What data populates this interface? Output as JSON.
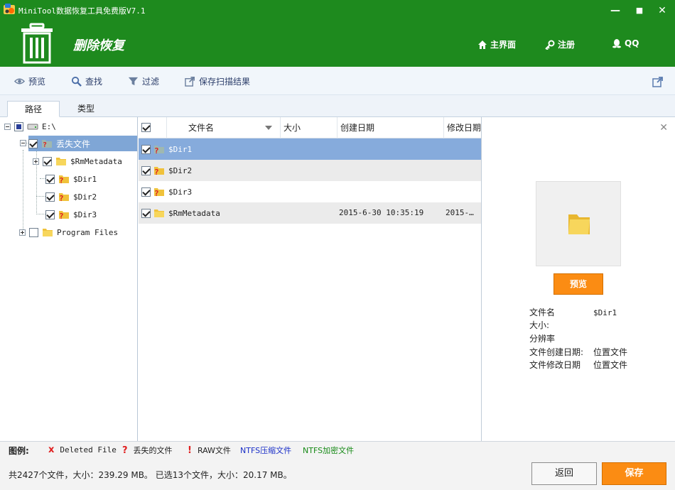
{
  "window": {
    "title": "MiniTool数据恢复工具免费版V7.1",
    "minimize": "—",
    "maximize": "■",
    "close": "✕"
  },
  "header": {
    "mode_title": "删除恢复",
    "nav": {
      "home": "主界面",
      "register": "注册",
      "qq": "QQ"
    }
  },
  "toolbar": {
    "preview": "预览",
    "find": "查找",
    "filter": "过滤",
    "save_scan": "保存扫描结果"
  },
  "tabs": {
    "path": "路径",
    "type": "类型"
  },
  "tree": {
    "root": "E:\\",
    "lost_files": "丢失文件",
    "children": [
      "$RmMetadata",
      "$Dir1",
      "$Dir2",
      "$Dir3"
    ],
    "program_files": "Program Files"
  },
  "list": {
    "columns": {
      "name": "文件名",
      "size": "大小",
      "created": "创建日期",
      "modified": "修改日期"
    },
    "rows": [
      {
        "name": "$Dir1",
        "size": "",
        "created": "",
        "modified": ""
      },
      {
        "name": "$Dir2",
        "size": "",
        "created": "",
        "modified": ""
      },
      {
        "name": "$Dir3",
        "size": "",
        "created": "",
        "modified": ""
      },
      {
        "name": "$RmMetadata",
        "size": "",
        "created": "2015-6-30 10:35:19",
        "modified": "2015-…"
      }
    ]
  },
  "preview": {
    "button": "预览",
    "fields": {
      "name_label": "文件名",
      "name_value": "$Dir1",
      "size_label": "大小:",
      "size_value": "",
      "resolution_label": "分辨率",
      "resolution_value": "",
      "created_label": "文件创建日期:",
      "created_value": "位置文件",
      "modified_label": "文件修改日期",
      "modified_value": "位置文件"
    }
  },
  "legend": {
    "title": "图例:",
    "deleted_mark": "x",
    "deleted": "Deleted File",
    "lost_mark": "?",
    "lost": "丢失的文件",
    "raw_mark": "!",
    "raw": "RAW文件",
    "ntfs_compressed": "NTFS压缩文件",
    "ntfs_encrypted": "NTFS加密文件",
    "colors": {
      "deleted": "#e02020",
      "lost": "#e02020",
      "raw": "#e02020",
      "ntfs_compressed": "#1a2fc8",
      "ntfs_encrypted": "#178a17"
    }
  },
  "status": {
    "summary": "共2427个文件，大小：239.29 MB。 已选13个文件，大小：20.17 MB。",
    "back": "返回",
    "save": "保存"
  },
  "colors": {
    "header_green": "#1e8a1e",
    "accent_orange": "#fb8c13",
    "selection_blue": "#86abdc"
  }
}
